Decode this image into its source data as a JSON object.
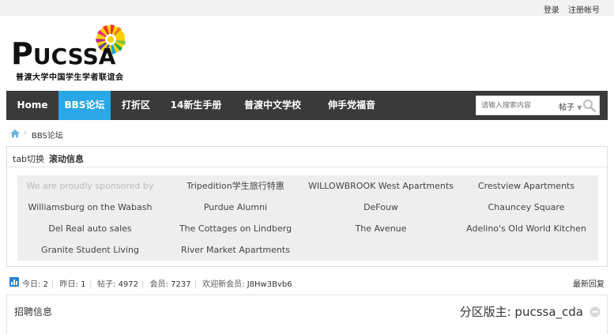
{
  "topbar": {
    "links": [
      "登录",
      "注册帐号"
    ]
  },
  "logo": {
    "brand_initial": "P",
    "brand_rest": "UCSSA",
    "subtitle": "普渡大学中国学生学者联谊会"
  },
  "nav": {
    "items": [
      {
        "label": "Home"
      },
      {
        "label": "BBS论坛"
      },
      {
        "label": "打折区"
      },
      {
        "label": "14新生手册"
      },
      {
        "label": "普渡中文学校"
      },
      {
        "label": "伸手党福音"
      }
    ],
    "search": {
      "placeholder": "请输入搜索内容",
      "type_label": "帖子",
      "caret": "▼"
    }
  },
  "breadcrumb": {
    "current": "BBS论坛",
    "sep": "›"
  },
  "tabs": {
    "tab1": "tab切换",
    "tab2": "滚动信息"
  },
  "sponsors": [
    "We are proudly sponsored by",
    "Tripedition学生旅行特惠",
    "WILLOWBROOK West Apartments",
    "Crestview Apartments",
    "Williamsburg on the Wabash",
    "Purdue Alumni",
    "DeFouw",
    "Chauncey Square",
    "Del Real auto sales",
    "The Cottages on Lindberg",
    "The Avenue",
    "Adelino's Old World Kitchen",
    "Granite Student Living",
    "River Market Apartments"
  ],
  "stats": {
    "today_label": "今日:",
    "today": "2",
    "yesterday_label": "昨日:",
    "yesterday": "1",
    "posts_label": "帖子:",
    "posts": "4972",
    "members_label": "会员:",
    "members": "7237",
    "newest_label": "欢迎新会员:",
    "newest": "J8Hw3Bvb6",
    "latest_reply": "最新回复"
  },
  "forum": {
    "title": "招聘信息",
    "moderator": "分区版主: pucssa_cda"
  },
  "colors": {
    "nav_bg": "#3a3a3a",
    "nav_active": "#2aa7e6",
    "sponsor_bg": "#eeeeee"
  }
}
